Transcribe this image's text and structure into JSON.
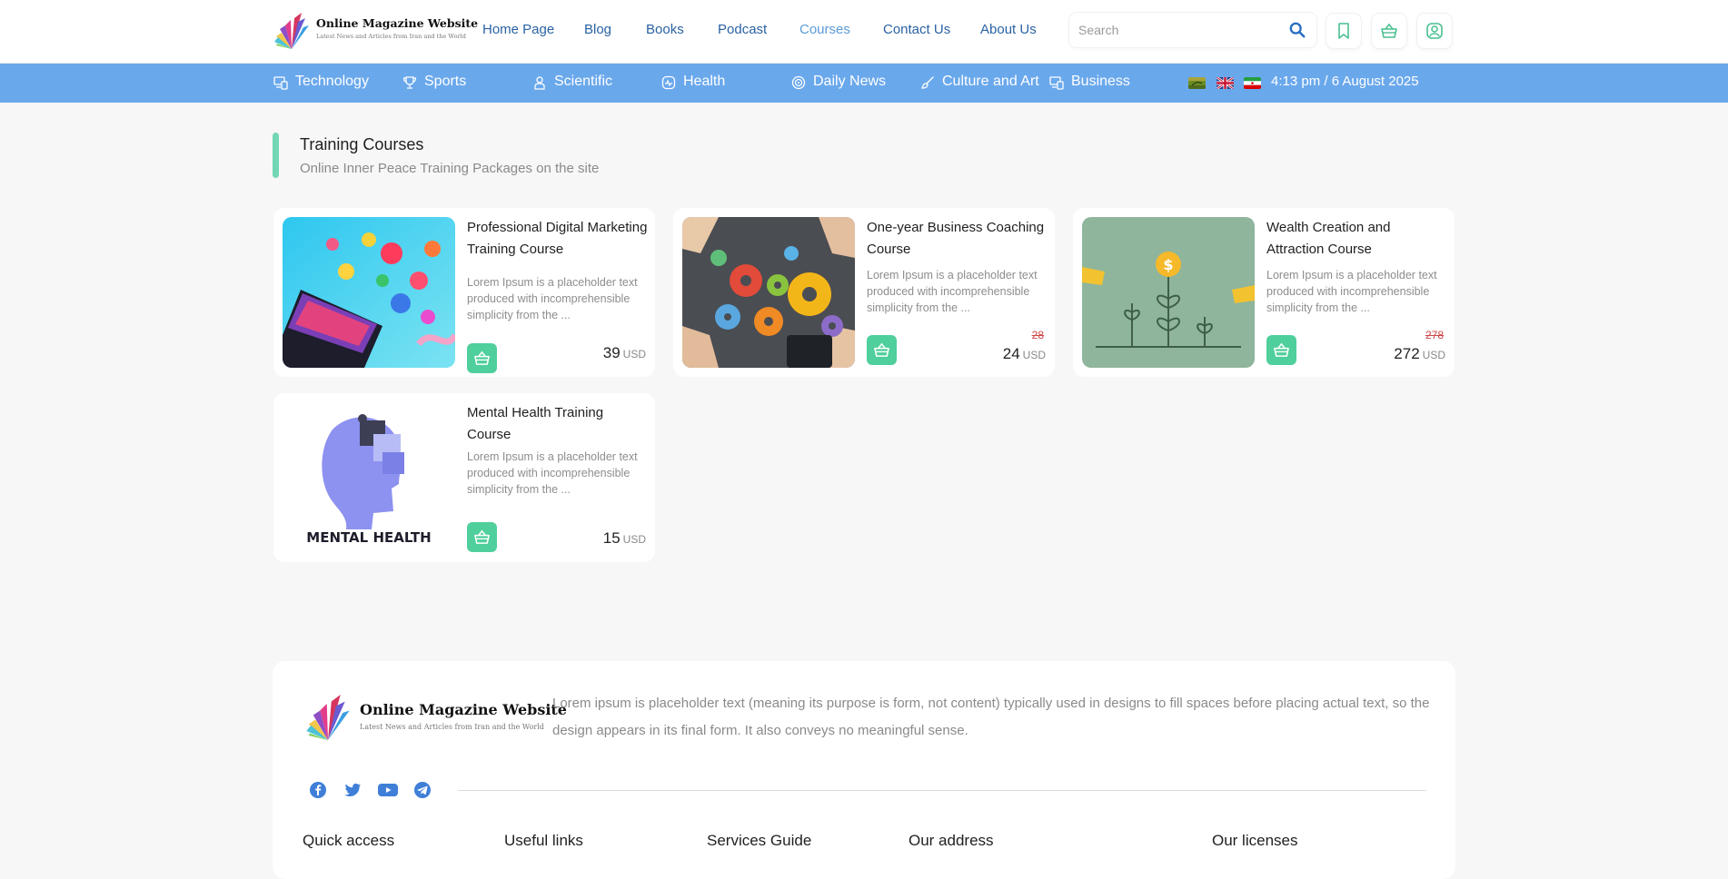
{
  "site": {
    "title": "Online Magazine Website",
    "subtitle": "Latest News and Articles from Iran and the World"
  },
  "nav": {
    "items": [
      {
        "label": "Home Page",
        "active": false
      },
      {
        "label": "Blog",
        "active": false
      },
      {
        "label": "Books",
        "active": false
      },
      {
        "label": "Podcast",
        "active": false
      },
      {
        "label": "Courses",
        "active": true
      },
      {
        "label": "Contact Us",
        "active": false
      },
      {
        "label": "About Us",
        "active": false
      }
    ]
  },
  "search": {
    "placeholder": "Search"
  },
  "header_icons": [
    "bookmark-icon",
    "basket-icon",
    "user-icon"
  ],
  "categories": [
    {
      "label": "Technology",
      "icon": "devices-icon"
    },
    {
      "label": "Sports",
      "icon": "trophy-icon"
    },
    {
      "label": "Scientific",
      "icon": "scientist-icon"
    },
    {
      "label": "Health",
      "icon": "health-icon"
    },
    {
      "label": "Daily News",
      "icon": "news-icon"
    },
    {
      "label": "Culture and Art",
      "icon": "brush-icon"
    },
    {
      "label": "Business",
      "icon": "business-icon"
    }
  ],
  "languages": [
    "flag-afghanistan",
    "flag-uk",
    "flag-iran"
  ],
  "datetime": "4:13 pm / 6 August 2025",
  "section": {
    "title": "Training Courses",
    "subtitle": "Online Inner Peace Training Packages on the site"
  },
  "courses": [
    {
      "title": "Professional Digital Marketing Training Course",
      "description": "Lorem Ipsum is a placeholder text produced with incomprehensible simplicity from the ...",
      "price": "39",
      "old_price": "",
      "currency": "USD",
      "image": "social-media-laptop"
    },
    {
      "title": "One-year Business Coaching Course",
      "description": "Lorem Ipsum is a placeholder text produced with incomprehensible simplicity from the ...",
      "price": "24",
      "old_price": "28",
      "currency": "USD",
      "image": "colorful-gears"
    },
    {
      "title": "Wealth Creation and Attraction Course",
      "description": "Lorem Ipsum is a placeholder text produced with incomprehensible simplicity from the ...",
      "price": "272",
      "old_price": "278",
      "currency": "USD",
      "image": "money-plants"
    },
    {
      "title": "Mental Health Training Course",
      "description": "Lorem Ipsum is a placeholder text produced with incomprehensible simplicity from the ...",
      "price": "15",
      "old_price": "",
      "currency": "USD",
      "image": "mental-health-head",
      "image_text": "MENTAL HEALTH"
    }
  ],
  "footer": {
    "description": "Lorem ipsum is placeholder text (meaning its purpose is form, not content) typically used in designs to fill spaces before placing actual text, so the design appears in its final form. It also conveys no meaningful sense.",
    "social": [
      "facebook-icon",
      "twitter-icon",
      "youtube-icon",
      "telegram-icon"
    ],
    "columns": [
      "Quick access",
      "Useful links",
      "Services Guide",
      "Our address",
      "Our licenses"
    ]
  },
  "colors": {
    "nav_text": "#2a62a3",
    "category_bar": "#6aa8ec",
    "accent_green": "#4fcf9b",
    "old_price_red": "#d04545"
  }
}
